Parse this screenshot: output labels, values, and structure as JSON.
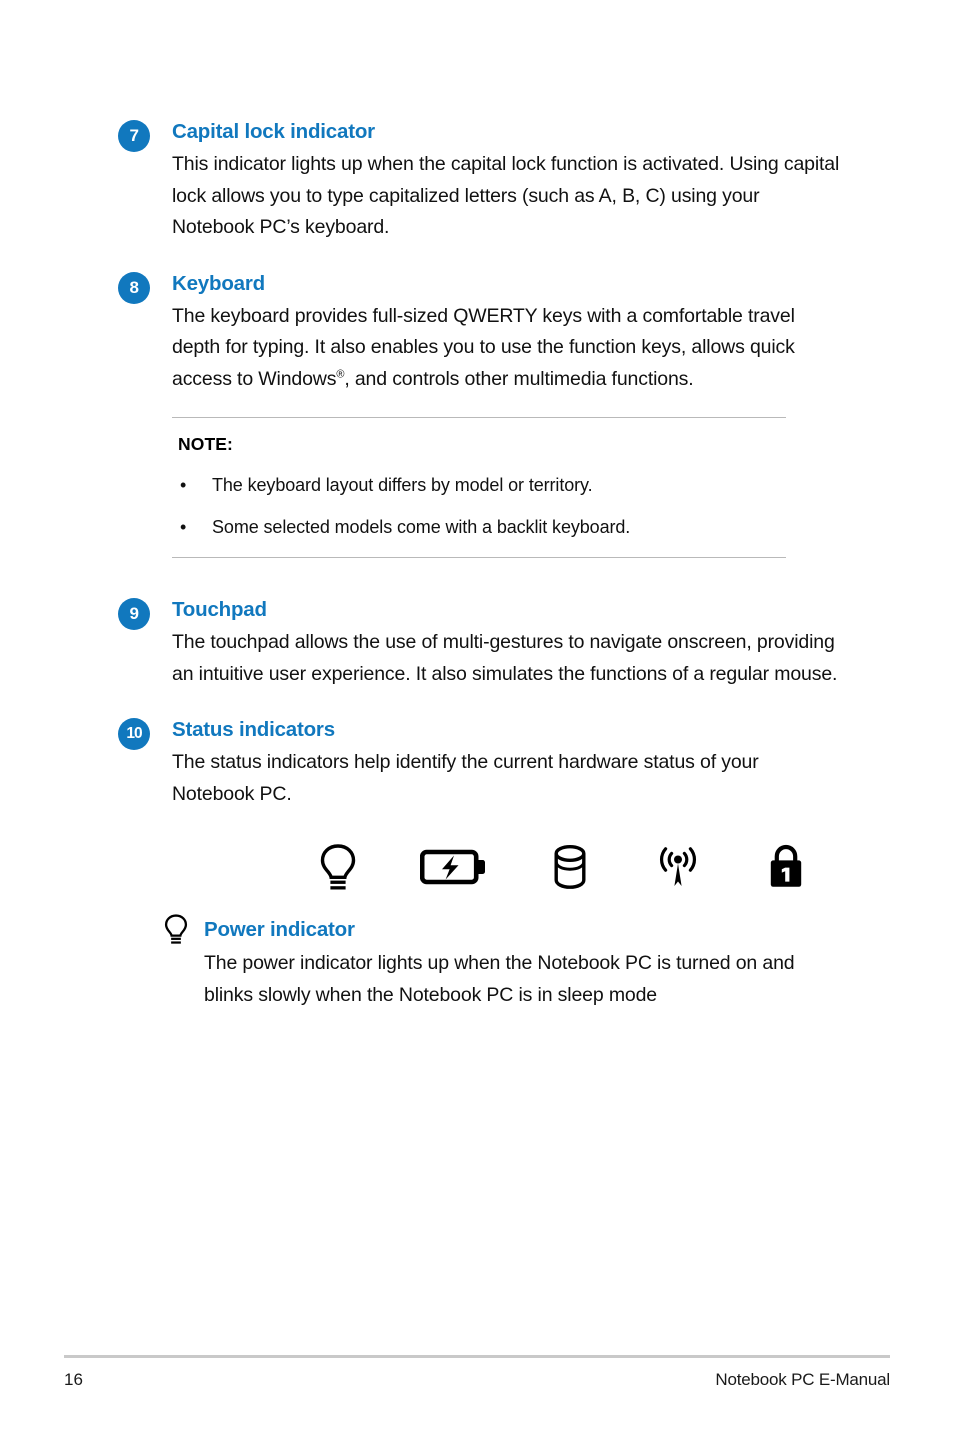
{
  "document": {
    "sections": [
      {
        "number": "7",
        "title": "Capital lock indicator",
        "body": "This indicator lights up when the capital lock function is activated. Using capital lock allows you to type capitalized letters (such as A, B, C) using your Notebook PC’s keyboard."
      },
      {
        "number": "8",
        "title": "Keyboard",
        "body_before_sup": "The keyboard provides full-sized QWERTY keys with a comfortable travel depth for typing. It also enables you to use the function keys, allows quick access to Windows",
        "body_sup": "®",
        "body_after_sup": ", and controls other multimedia functions."
      },
      {
        "number": "9",
        "title": "Touchpad",
        "body": "The touchpad allows the use of multi-gestures to navigate onscreen, providing an intuitive user experience. It also simulates the functions of a regular mouse."
      },
      {
        "number": "10",
        "title": "Status indicators",
        "body": "The status indicators help identify the current hardware status of your Notebook PC."
      }
    ],
    "note": {
      "title": "NOTE:",
      "bullet": "•",
      "items": [
        "The keyboard layout differs by model or territory.",
        "Some selected models come with a backlit keyboard."
      ]
    },
    "status_icons": [
      {
        "name": "power-indicator-icon",
        "label": "power indicator"
      },
      {
        "name": "battery-charge-indicator-icon",
        "label": "two-color battery charge indicator"
      },
      {
        "name": "drive-activity-indicator-icon",
        "label": "drive activity indicator"
      },
      {
        "name": "bluetooth-wireless-indicator-icon",
        "label": "bluetooth / wireless indicator"
      },
      {
        "name": "capital-lock-indicator-icon",
        "label": "capital lock indicator"
      }
    ],
    "power_indicator": {
      "icon": "power-indicator-icon",
      "title": "Power indicator",
      "body": "The power indicator lights up when the Notebook PC is turned on and blinks slowly when the Notebook PC is in sleep mode"
    },
    "footer": {
      "page_number": "16",
      "manual_title": "Notebook PC E-Manual"
    },
    "colors": {
      "accent_blue": "#1178be",
      "body_text": "#111111",
      "rule_gray": "#b9b9b9",
      "footer_rule": "#c9c9c9"
    }
  }
}
